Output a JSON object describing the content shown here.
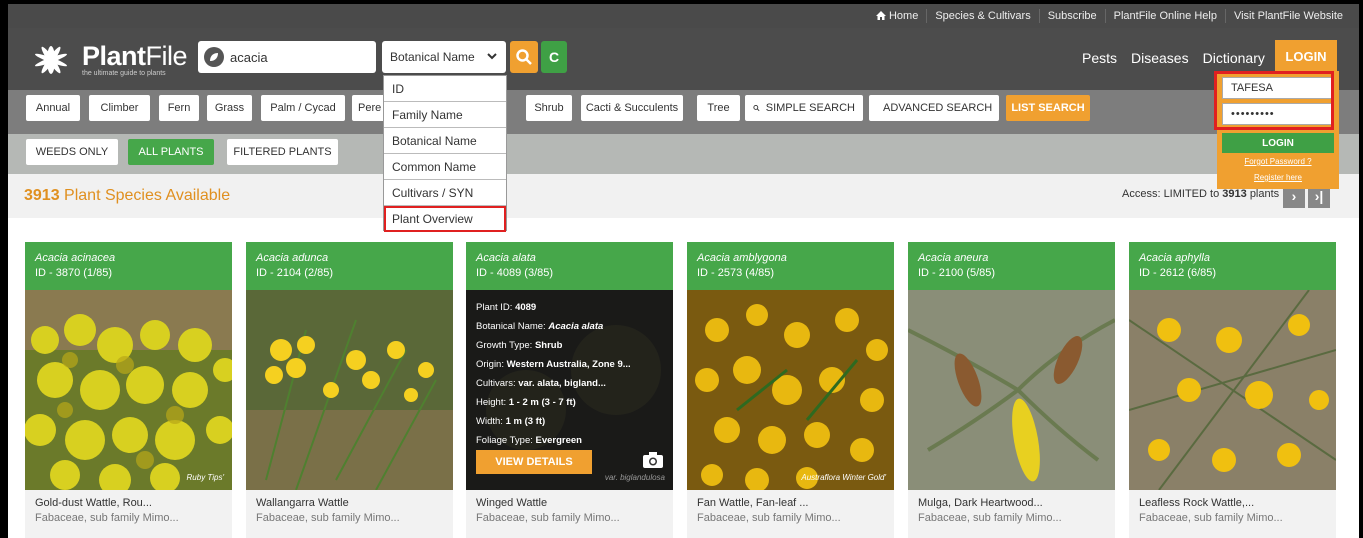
{
  "toplinks": [
    "Home",
    "Species & Cultivars",
    "Subscribe",
    "PlantFile Online Help",
    "Visit PlantFile Website"
  ],
  "logo": {
    "name_bold": "Plant",
    "name_light": "File",
    "tagline": "the ultimate guide to plants"
  },
  "search": {
    "value": "acacia",
    "placeholder": ""
  },
  "search_mode": {
    "selected": "Botanical Name"
  },
  "reset_label": "C",
  "mainnav": [
    "Pests",
    "Diseases",
    "Dictionary"
  ],
  "login_top_label": "LOGIN",
  "categories": [
    "Annual",
    "Climber",
    "Fern",
    "Grass",
    "Palm / Cycad",
    "Pere",
    "Shrub",
    "Cacti & Succulents",
    "Tree"
  ],
  "search_buttons": {
    "simple": "SIMPLE SEARCH",
    "advanced": "ADVANCED SEARCH",
    "list": "LIST SEARCH"
  },
  "filters": {
    "weeds": "WEEDS ONLY",
    "all": "ALL PLANTS",
    "filtered": "FILTERED PLANTS"
  },
  "count": {
    "number": "3913",
    "text": "Plant Species Available"
  },
  "access": {
    "prefix": "Access: LIMITED to",
    "number": "3913",
    "suffix": "plants"
  },
  "pager": {
    "next": "›",
    "last": "›|"
  },
  "dropdown": {
    "options": [
      "ID",
      "Family Name",
      "Botanical Name",
      "Common Name",
      "Cultivars / SYN",
      "Plant Overview"
    ],
    "highlighted": "Plant Overview"
  },
  "login_panel": {
    "username": "TAFESA",
    "password": "•••••••••",
    "button": "LOGIN",
    "forgot": "Forgot Password ?",
    "register": "Register here"
  },
  "cards": [
    {
      "name": "Acacia acinacea",
      "id": "ID - 3870 (1/85)",
      "common": "Gold-dust Wattle, Rou...",
      "family": "Fabaceae, sub family Mimo...",
      "watermark": "Ruby Tips'"
    },
    {
      "name": "Acacia adunca",
      "id": "ID - 2104 (2/85)",
      "common": "Wallangarra Wattle",
      "family": "Fabaceae, sub family Mimo...",
      "watermark": ""
    },
    {
      "name": "Acacia alata",
      "id": "ID - 4089 (3/85)",
      "common": "Winged Wattle",
      "family": "Fabaceae, sub family Mimo...",
      "watermark": "var. biglandulosa"
    },
    {
      "name": "Acacia amblygona",
      "id": "ID - 2573 (4/85)",
      "common": "Fan Wattle, Fan-leaf ...",
      "family": "Fabaceae, sub family Mimo...",
      "watermark": "Austraflora Winter Gold'"
    },
    {
      "name": "Acacia aneura",
      "id": "ID - 2100 (5/85)",
      "common": "Mulga, Dark Heartwood...",
      "family": "Fabaceae, sub family Mimo...",
      "watermark": ""
    },
    {
      "name": "Acacia aphylla",
      "id": "ID - 2612 (6/85)",
      "common": "Leafless Rock Wattle,...",
      "family": "Fabaceae, sub family Mimo...",
      "watermark": ""
    }
  ],
  "overlay": {
    "lines": [
      {
        "label": "Plant ID: ",
        "value": "4089"
      },
      {
        "label": "Botanical Name: ",
        "value": "Acacia alata"
      },
      {
        "label": "Growth Type: ",
        "value": "Shrub"
      },
      {
        "label": "Origin: ",
        "value": "Western Australia, Zone 9..."
      },
      {
        "label": "Cultivars: ",
        "value": "var. alata, bigland..."
      },
      {
        "label": "Height: ",
        "value": "1 - 2 m (3 - 7 ft)"
      },
      {
        "label": "Width: ",
        "value": "1 m (3 ft)"
      },
      {
        "label": "Foliage Type: ",
        "value": "Evergreen"
      }
    ],
    "button": "VIEW DETAILS"
  },
  "colors": {
    "accent_orange": "#f0a030",
    "brand_green": "#46a74a",
    "highlight_red": "#e02020",
    "header_dark": "#4c4c4c"
  },
  "icons": [
    "home-icon",
    "plant-logo-icon",
    "leaf-icon",
    "chevron-down-icon",
    "search-icon",
    "refresh-icon",
    "camera-icon"
  ]
}
